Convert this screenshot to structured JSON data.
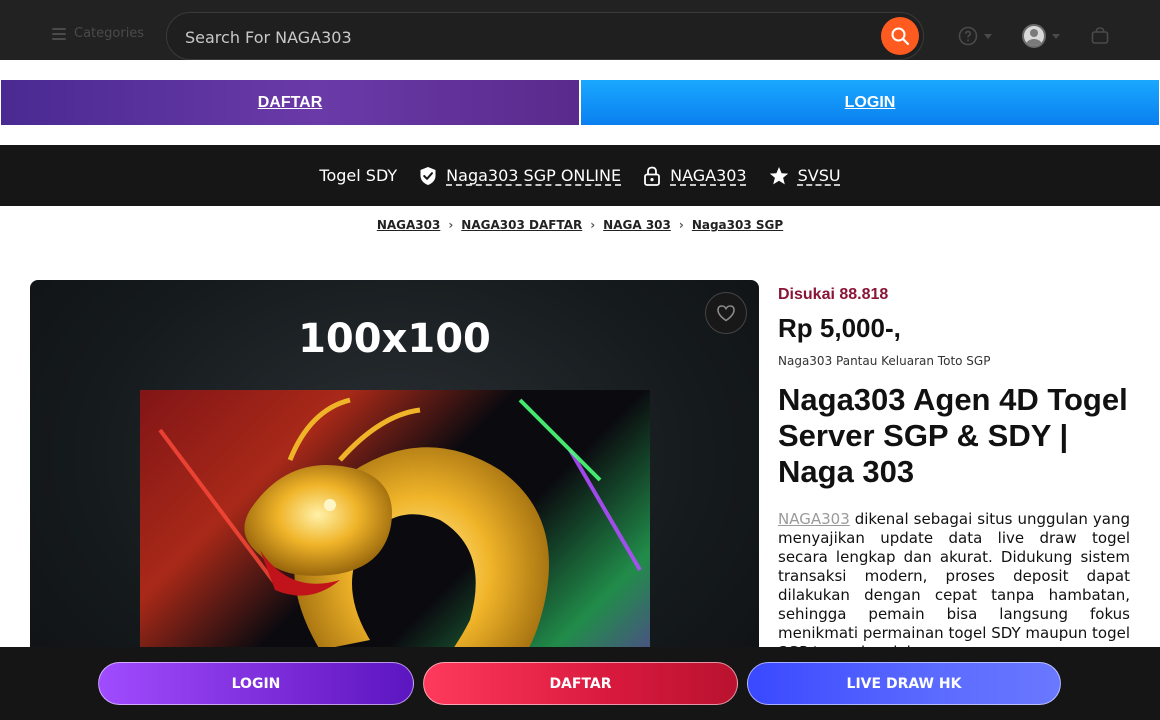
{
  "header": {
    "categories_label": "Categories",
    "search_placeholder": "Search For NAGA303"
  },
  "auth_bar": {
    "daftar": "DAFTAR",
    "login": "LOGIN"
  },
  "nav": {
    "items": [
      {
        "label": "Togel SDY",
        "icon": "none"
      },
      {
        "label": "Naga303 SGP ONLINE",
        "icon": "verified-shield-icon"
      },
      {
        "label": "NAGA303",
        "icon": "lock-icon"
      },
      {
        "label": "SVSU",
        "icon": "star-icon"
      }
    ]
  },
  "breadcrumb": [
    "NAGA303",
    "NAGA303 DAFTAR",
    "NAGA 303",
    "Naga303 SGP"
  ],
  "product": {
    "image_caption": "100x100",
    "likes": "Disukai 88.818",
    "price": "Rp 5,000-,",
    "subtitle": "Naga303 Pantau Keluaran Toto SGP",
    "title": "Naga303 Agen 4D Togel Server SGP & SDY | Naga 303",
    "desc_link": "NAGA303",
    "desc_text": " dikenal sebagai situs unggulan yang menyajikan update data live draw togel secara lengkap dan akurat. Didukung sistem transaksi modern, proses deposit dapat dilakukan dengan cepat tanpa hambatan, sehingga pemain bisa langsung fokus menikmati permainan togel SDY maupun togel SGP tanpa kendala."
  },
  "bottom_bar": {
    "login": "LOGIN",
    "daftar": "DAFTAR",
    "live": "LIVE DRAW HK"
  },
  "colors": {
    "orange_search": "#ff5a1f",
    "likes": "#8a1538",
    "login_blue": "#0a7ff0",
    "daftar_purple": "#5a2a8c"
  }
}
